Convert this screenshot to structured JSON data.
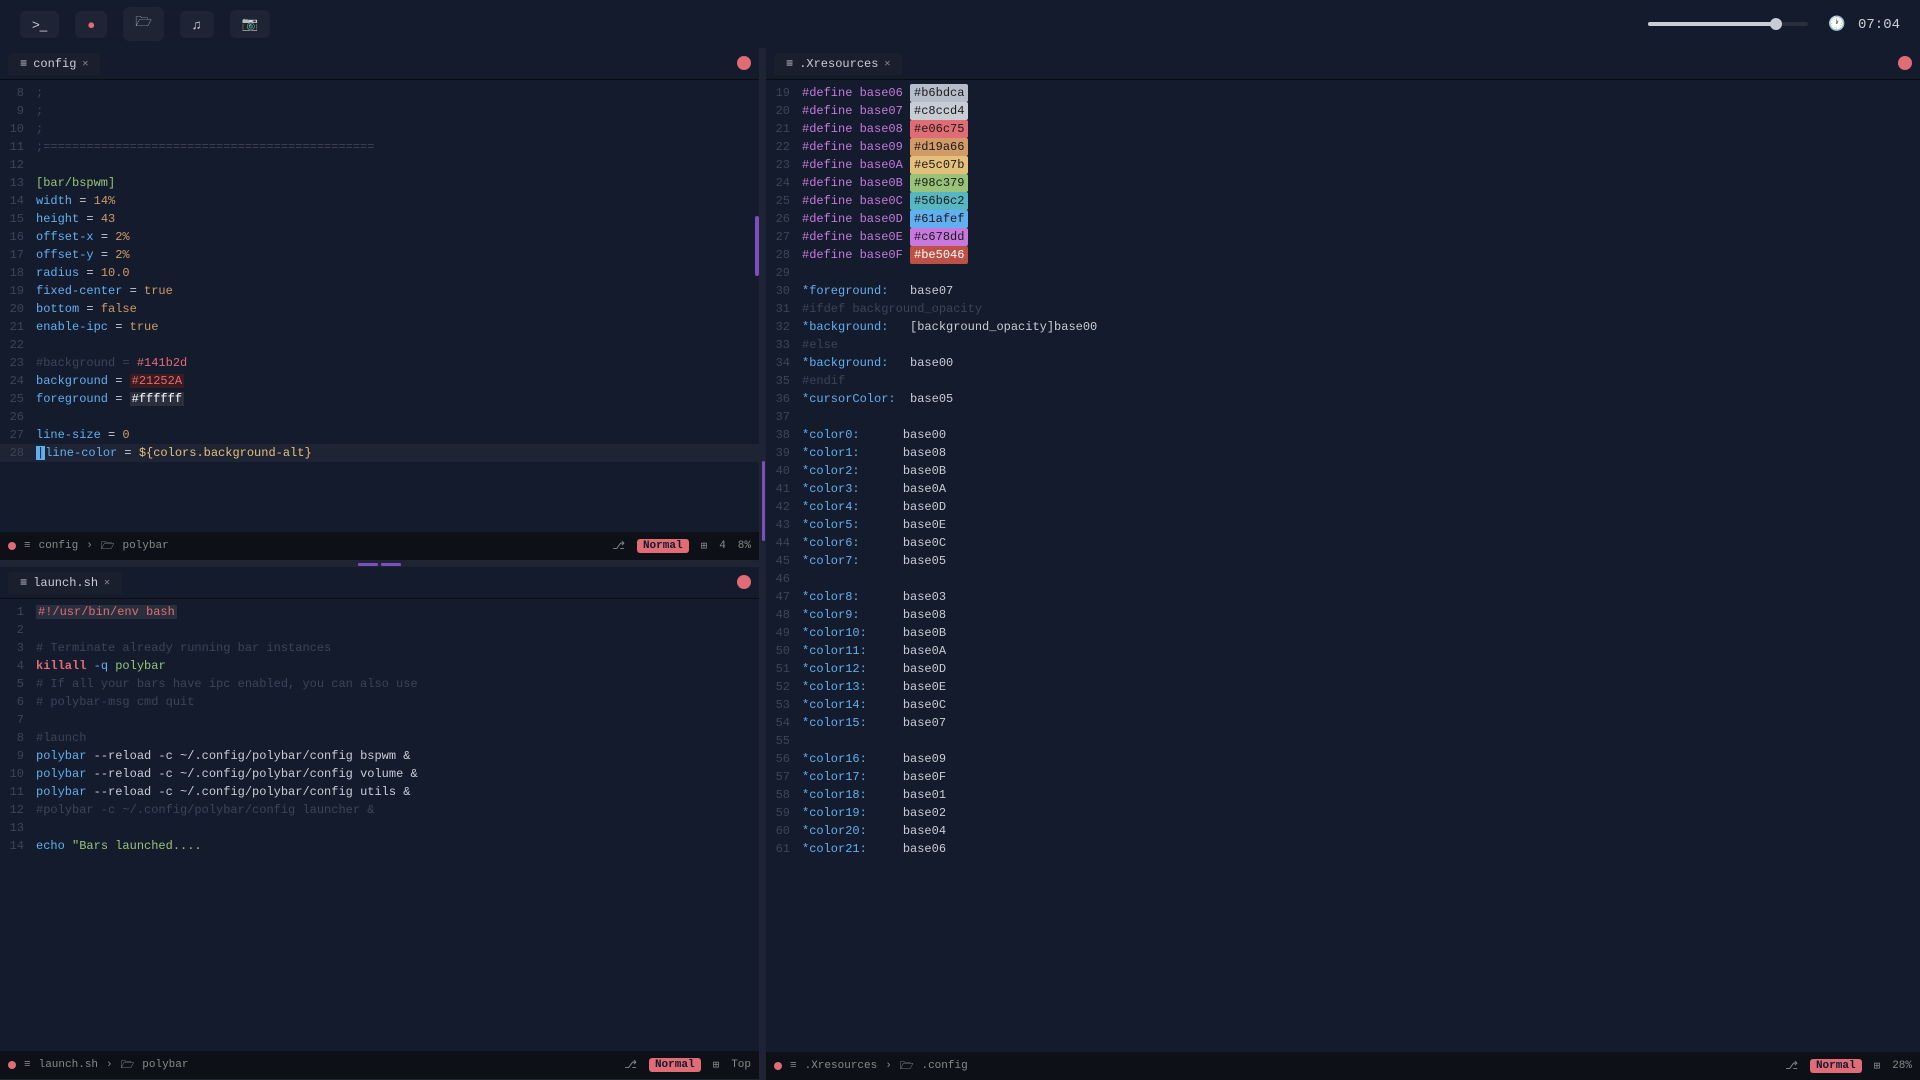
{
  "topbar": {
    "buttons": [
      {
        "label": ">_",
        "name": "terminal-btn"
      },
      {
        "label": "●",
        "name": "record-btn"
      },
      {
        "label": "📁",
        "name": "files-btn"
      },
      {
        "label": "♪",
        "name": "music-btn"
      },
      {
        "label": "📷",
        "name": "camera-btn"
      }
    ],
    "time": "07:04",
    "volume_percent": 80
  },
  "config_tab": {
    "title": "config",
    "mode": "Normal",
    "percent": "8%",
    "line_num": "4",
    "breadcrumb1": "config",
    "breadcrumb2": "polybar",
    "lines": [
      {
        "num": "8",
        "content": ";"
      },
      {
        "num": "9",
        "content": ";"
      },
      {
        "num": "10",
        "content": ";"
      },
      {
        "num": "11",
        "content": ";=============================================="
      },
      {
        "num": "12",
        "content": ""
      },
      {
        "num": "13",
        "content": "[bar/bspwm]",
        "type": "section"
      },
      {
        "num": "14",
        "content": "width = 14%"
      },
      {
        "num": "15",
        "content": "height = 43"
      },
      {
        "num": "16",
        "content": "offset-x = 2%"
      },
      {
        "num": "17",
        "content": "offset-y = 2%"
      },
      {
        "num": "18",
        "content": "radius = 10.0"
      },
      {
        "num": "19",
        "content": "fixed-center = true"
      },
      {
        "num": "20",
        "content": "bottom = false"
      },
      {
        "num": "21",
        "content": "enable-ipc = true"
      },
      {
        "num": "22",
        "content": ""
      },
      {
        "num": "23",
        "content": "#background = #141b2d",
        "type": "comment_hash"
      },
      {
        "num": "24",
        "content": "background = #21252A"
      },
      {
        "num": "25",
        "content": "foreground = #ffffff"
      },
      {
        "num": "26",
        "content": ""
      },
      {
        "num": "27",
        "content": "line-size = 0"
      },
      {
        "num": "28",
        "content": "line-color = ${colors.background-alt}",
        "type": "cursor"
      }
    ]
  },
  "launch_tab": {
    "title": "launch.sh",
    "mode": "Normal",
    "position": "Top",
    "breadcrumb1": "launch.sh",
    "breadcrumb2": "polybar",
    "lines": [
      {
        "num": "1",
        "content": "#!/usr/bin/env bash"
      },
      {
        "num": "2",
        "content": ""
      },
      {
        "num": "3",
        "content": "# Terminate already running bar instances",
        "type": "comment"
      },
      {
        "num": "4",
        "content": "killall -q polybar",
        "type": "cmd"
      },
      {
        "num": "5",
        "content": "# If all your bars have ipc enabled, you can also use",
        "type": "comment"
      },
      {
        "num": "6",
        "content": "# polybar-msg cmd quit",
        "type": "comment"
      },
      {
        "num": "7",
        "content": ""
      },
      {
        "num": "8",
        "content": "#launch",
        "type": "comment"
      },
      {
        "num": "9",
        "content": "polybar --reload -c ~/.config/polybar/config bspwm &"
      },
      {
        "num": "10",
        "content": "polybar --reload -c ~/.config/polybar/config volume &"
      },
      {
        "num": "11",
        "content": "polybar --reload -c ~/.config/polybar/config utils &"
      },
      {
        "num": "12",
        "content": "#polybar -c ~/.config/polybar/config launcher &",
        "type": "comment"
      },
      {
        "num": "13",
        "content": ""
      },
      {
        "num": "14",
        "content": "echo \"Bars launched...."
      }
    ]
  },
  "xresources_tab": {
    "title": ".Xresources",
    "mode": "Normal",
    "percent": "28%",
    "breadcrumb1": ".Xresources",
    "breadcrumb2": ".config",
    "lines": [
      {
        "num": "19",
        "key": "#define base06",
        "value": "#b6bdca",
        "swatch": "b6bdca"
      },
      {
        "num": "20",
        "key": "#define base07",
        "value": "#c8ccd4",
        "swatch": "c8ccd4"
      },
      {
        "num": "21",
        "key": "#define base08",
        "value": "#e06c75",
        "swatch": "e06c75"
      },
      {
        "num": "22",
        "key": "#define base09",
        "value": "#d19a66",
        "swatch": "d19a66"
      },
      {
        "num": "23",
        "key": "#define base0A",
        "value": "#e5c07b",
        "swatch": "e5c07b"
      },
      {
        "num": "24",
        "key": "#define base0B",
        "value": "#98c379",
        "swatch": "98c379"
      },
      {
        "num": "25",
        "key": "#define base0C",
        "value": "#56b6c2",
        "swatch": "56b6c2"
      },
      {
        "num": "26",
        "key": "#define base0D",
        "value": "#61afef",
        "swatch": "61afef"
      },
      {
        "num": "27",
        "key": "#define base0E",
        "value": "#c678dd",
        "swatch": "c678dd"
      },
      {
        "num": "28",
        "key": "#define base0F",
        "value": "#be5046",
        "swatch": "be5046"
      },
      {
        "num": "29",
        "key": "",
        "value": ""
      },
      {
        "num": "30",
        "key": "*foreground:",
        "value": "   base07",
        "plain": true
      },
      {
        "num": "31",
        "key": "#ifdef background_opacity",
        "value": "",
        "comment": true
      },
      {
        "num": "32",
        "key": "*background:",
        "value": "   [background_opacity]base00",
        "plain": true
      },
      {
        "num": "33",
        "key": "#else",
        "value": "",
        "comment": true
      },
      {
        "num": "34",
        "key": "*background:",
        "value": "   base00",
        "plain": true
      },
      {
        "num": "35",
        "key": "#endif",
        "value": "",
        "comment": true
      },
      {
        "num": "36",
        "key": "*cursorColor:",
        "value": "  base05",
        "plain": true
      },
      {
        "num": "37",
        "key": "",
        "value": ""
      },
      {
        "num": "38",
        "key": "*color0:",
        "value": "     base00",
        "plain": true
      },
      {
        "num": "39",
        "key": "*color1:",
        "value": "     base08",
        "plain": true
      },
      {
        "num": "40",
        "key": "*color2:",
        "value": "     base0B",
        "plain": true
      },
      {
        "num": "41",
        "key": "*color3:",
        "value": "     base0A",
        "plain": true
      },
      {
        "num": "42",
        "key": "*color4:",
        "value": "     base0D",
        "plain": true
      },
      {
        "num": "43",
        "key": "*color5:",
        "value": "     base0E",
        "plain": true
      },
      {
        "num": "44",
        "key": "*color6:",
        "value": "     base0C",
        "plain": true
      },
      {
        "num": "45",
        "key": "*color7:",
        "value": "     base05",
        "plain": true
      },
      {
        "num": "46",
        "key": "",
        "value": ""
      },
      {
        "num": "47",
        "key": "*color8:",
        "value": "     base03",
        "plain": true
      },
      {
        "num": "48",
        "key": "*color9:",
        "value": "     base08",
        "plain": true
      },
      {
        "num": "49",
        "key": "*color10:",
        "value": "    base0B",
        "plain": true
      },
      {
        "num": "50",
        "key": "*color11:",
        "value": "    base0A",
        "plain": true
      },
      {
        "num": "51",
        "key": "*color12:",
        "value": "    base0D",
        "plain": true
      },
      {
        "num": "52",
        "key": "*color13:",
        "value": "    base0E",
        "plain": true
      },
      {
        "num": "53",
        "key": "*color14:",
        "value": "    base0C",
        "plain": true
      },
      {
        "num": "54",
        "key": "*color15:",
        "value": "    base07",
        "plain": true
      },
      {
        "num": "55",
        "key": "",
        "value": ""
      },
      {
        "num": "56",
        "key": "*color16:",
        "value": "    base09",
        "plain": true
      },
      {
        "num": "57",
        "key": "*color17:",
        "value": "    base0F",
        "plain": true
      },
      {
        "num": "58",
        "key": "*color18:",
        "value": "    base01",
        "plain": true
      },
      {
        "num": "59",
        "key": "*color19:",
        "value": "    base02",
        "plain": true
      },
      {
        "num": "60",
        "key": "*color20:",
        "value": "    base04",
        "plain": true
      },
      {
        "num": "61",
        "key": "*color21:",
        "value": "    base06",
        "plain": true
      }
    ]
  }
}
